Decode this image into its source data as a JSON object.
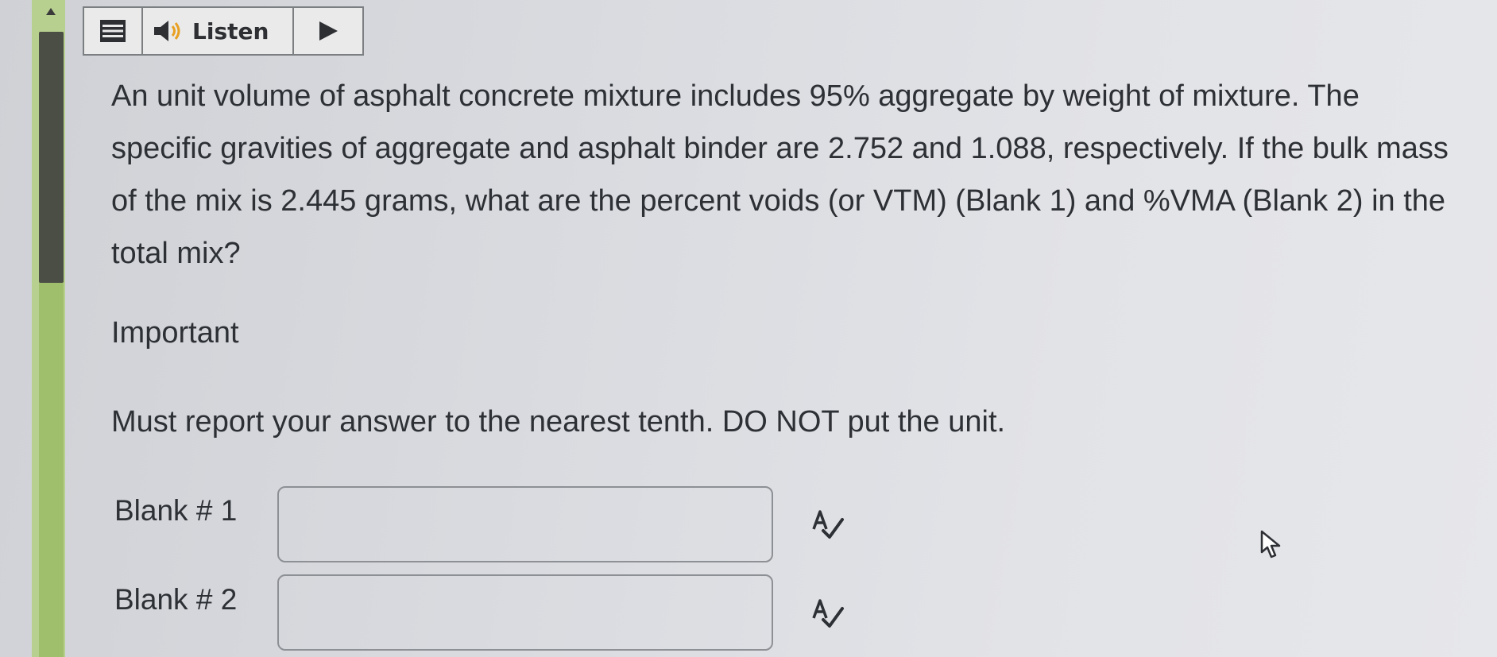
{
  "toolbar": {
    "menu_icon": "hamburger-menu-icon",
    "speaker_icon": "speaker-icon",
    "listen_label": "Listen",
    "play_icon": "play-icon"
  },
  "question": {
    "text": "An unit volume of asphalt concrete mixture includes 95% aggregate by weight of mixture. The specific gravities of aggregate and asphalt binder are 2.752 and 1.088, respectively. If the bulk mass of the mix is 2.445 grams, what are the percent voids (or VTM) (Blank 1) and %VMA (Blank 2) in the total mix?"
  },
  "important_label": "Important",
  "instruction": "Must report your answer to the nearest tenth. DO NOT put the unit.",
  "blanks": [
    {
      "label": "Blank # 1",
      "value": "",
      "placeholder": ""
    },
    {
      "label": "Blank # 2",
      "value": "",
      "placeholder": ""
    }
  ],
  "icons": {
    "spellcheck": "spellcheck-icon",
    "cursor": "mouse-cursor-icon"
  },
  "colors": {
    "left_bar": "#b7cf8f",
    "scroll_thumb": "#4b4e44",
    "text": "#2d3035"
  }
}
